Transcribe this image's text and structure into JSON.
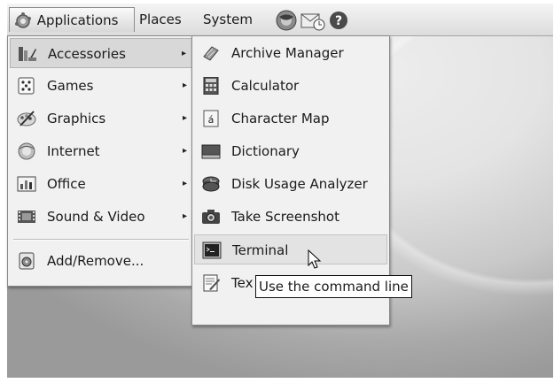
{
  "panel": {
    "applications_label": "Applications",
    "places_label": "Places",
    "system_label": "System"
  },
  "main_menu": {
    "items": [
      {
        "label": "Accessories",
        "icon": "accessories-icon",
        "has_submenu": true,
        "state": "selected"
      },
      {
        "label": "Games",
        "icon": "games-icon",
        "has_submenu": true
      },
      {
        "label": "Graphics",
        "icon": "graphics-icon",
        "has_submenu": true
      },
      {
        "label": "Internet",
        "icon": "internet-icon",
        "has_submenu": true
      },
      {
        "label": "Office",
        "icon": "office-icon",
        "has_submenu": true
      },
      {
        "label": "Sound & Video",
        "icon": "sound-video-icon",
        "has_submenu": true
      },
      {
        "label": "Add/Remove...",
        "icon": "add-remove-icon",
        "has_submenu": false
      }
    ],
    "arrow_glyph": "▸"
  },
  "accessories_menu": {
    "items": [
      {
        "label": "Archive Manager",
        "icon": "archive-manager-icon"
      },
      {
        "label": "Calculator",
        "icon": "calculator-icon"
      },
      {
        "label": "Character Map",
        "icon": "character-map-icon",
        "glyph": "á"
      },
      {
        "label": "Dictionary",
        "icon": "dictionary-icon"
      },
      {
        "label": "Disk Usage Analyzer",
        "icon": "disk-usage-icon"
      },
      {
        "label": "Take Screenshot",
        "icon": "screenshot-icon"
      },
      {
        "label": "Terminal",
        "icon": "terminal-icon",
        "state": "hover"
      },
      {
        "label": "Tex",
        "icon": "text-editor-icon"
      }
    ]
  },
  "tooltip": {
    "text": "Use the command line"
  },
  "colors": {
    "menu_bg": "#f1f1f1",
    "selected_bg": "#d8d8d8",
    "panel_top": "#f4f4f4",
    "panel_bottom": "#dcdcdc"
  }
}
